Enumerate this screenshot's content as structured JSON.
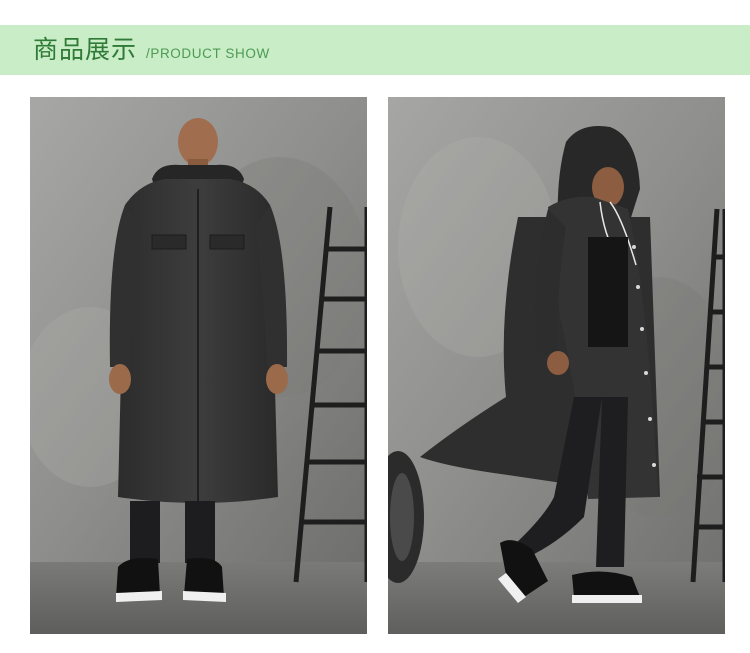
{
  "banner": {
    "title_cn": "商品展示",
    "title_en": "/PRODUCT SHOW",
    "bg_color": "#c9edc6",
    "text_color": "#2f7a37"
  },
  "photos": [
    {
      "subject": "man-standing-in-long-dark-raincoat",
      "backdrop": "grey-concrete-wall",
      "props": [
        "black-ladder"
      ]
    },
    {
      "subject": "man-walking-in-hooded-dark-raincoat",
      "backdrop": "grey-concrete-wall",
      "props": [
        "black-ladder",
        "tire"
      ]
    }
  ]
}
